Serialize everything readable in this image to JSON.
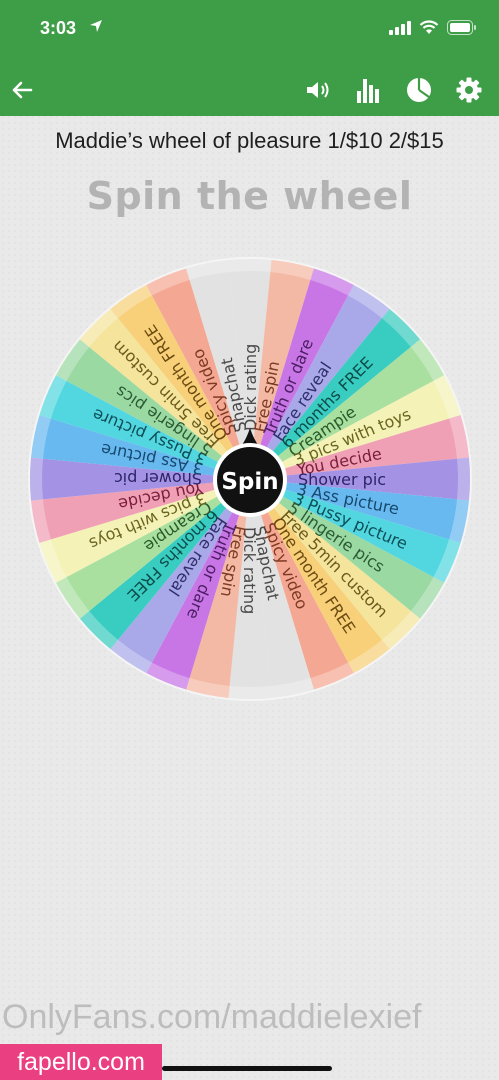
{
  "status_bar": {
    "time": "3:03"
  },
  "app_bar": {
    "back_icon": "arrow-left-icon",
    "icons": [
      "speaker-icon",
      "bar-chart-icon",
      "pie-chart-icon",
      "gear-icon"
    ]
  },
  "subtitle": "Maddie’s wheel of pleasure 1/$10 2/$15",
  "title": "Spin the wheel",
  "wheel": {
    "spin_label": "Spin",
    "segments": [
      "Dick rating",
      "Free spin",
      "Truth or dare",
      "Face reveal",
      "6 months FREE",
      "Creampie",
      "3 pics with toys",
      "You decide",
      "Shower pic",
      "3 Ass picture",
      "3 Pussy picture",
      "5 lingerie pics",
      "Free 5min custom",
      "One month FREE",
      "Spicy video",
      "Snapchat",
      "Dick rating",
      "Free spin",
      "Truth or dare",
      "Face reveal",
      "6 months FREE",
      "Creampie",
      "3 pics with toys",
      "You decide",
      "Shower pic",
      "3 Ass picture",
      "3 Pussy picture",
      "5 lingerie pics",
      "Free 5min custom",
      "One month FREE",
      "Spicy video",
      "Snapchat"
    ],
    "colors": [
      "#e2e2e2",
      "#f4b9a4",
      "#c875e6",
      "#a9a9ea",
      "#39ccc0",
      "#a9e0a0",
      "#f4f2b6",
      "#f0a0b5",
      "#a493e4",
      "#68b9f0",
      "#52d7e0",
      "#9bd9a3",
      "#f4e49c",
      "#f7d079",
      "#f4a893",
      "#e2e2e2"
    ],
    "text_colors": [
      "#4a4a4a",
      "#7d3a22",
      "#4c1f63",
      "#2f2f6a",
      "#0d4c49",
      "#2a5a2a",
      "#6a6420",
      "#7a1d3c",
      "#2e2466",
      "#17496e",
      "#0e4e56",
      "#2a5a33",
      "#6a5a1c",
      "#6a4a10",
      "#7d3a22",
      "#4a4a4a"
    ]
  },
  "watermark": "OnlyFans.com/maddielexief",
  "badge": "fapello.com"
}
